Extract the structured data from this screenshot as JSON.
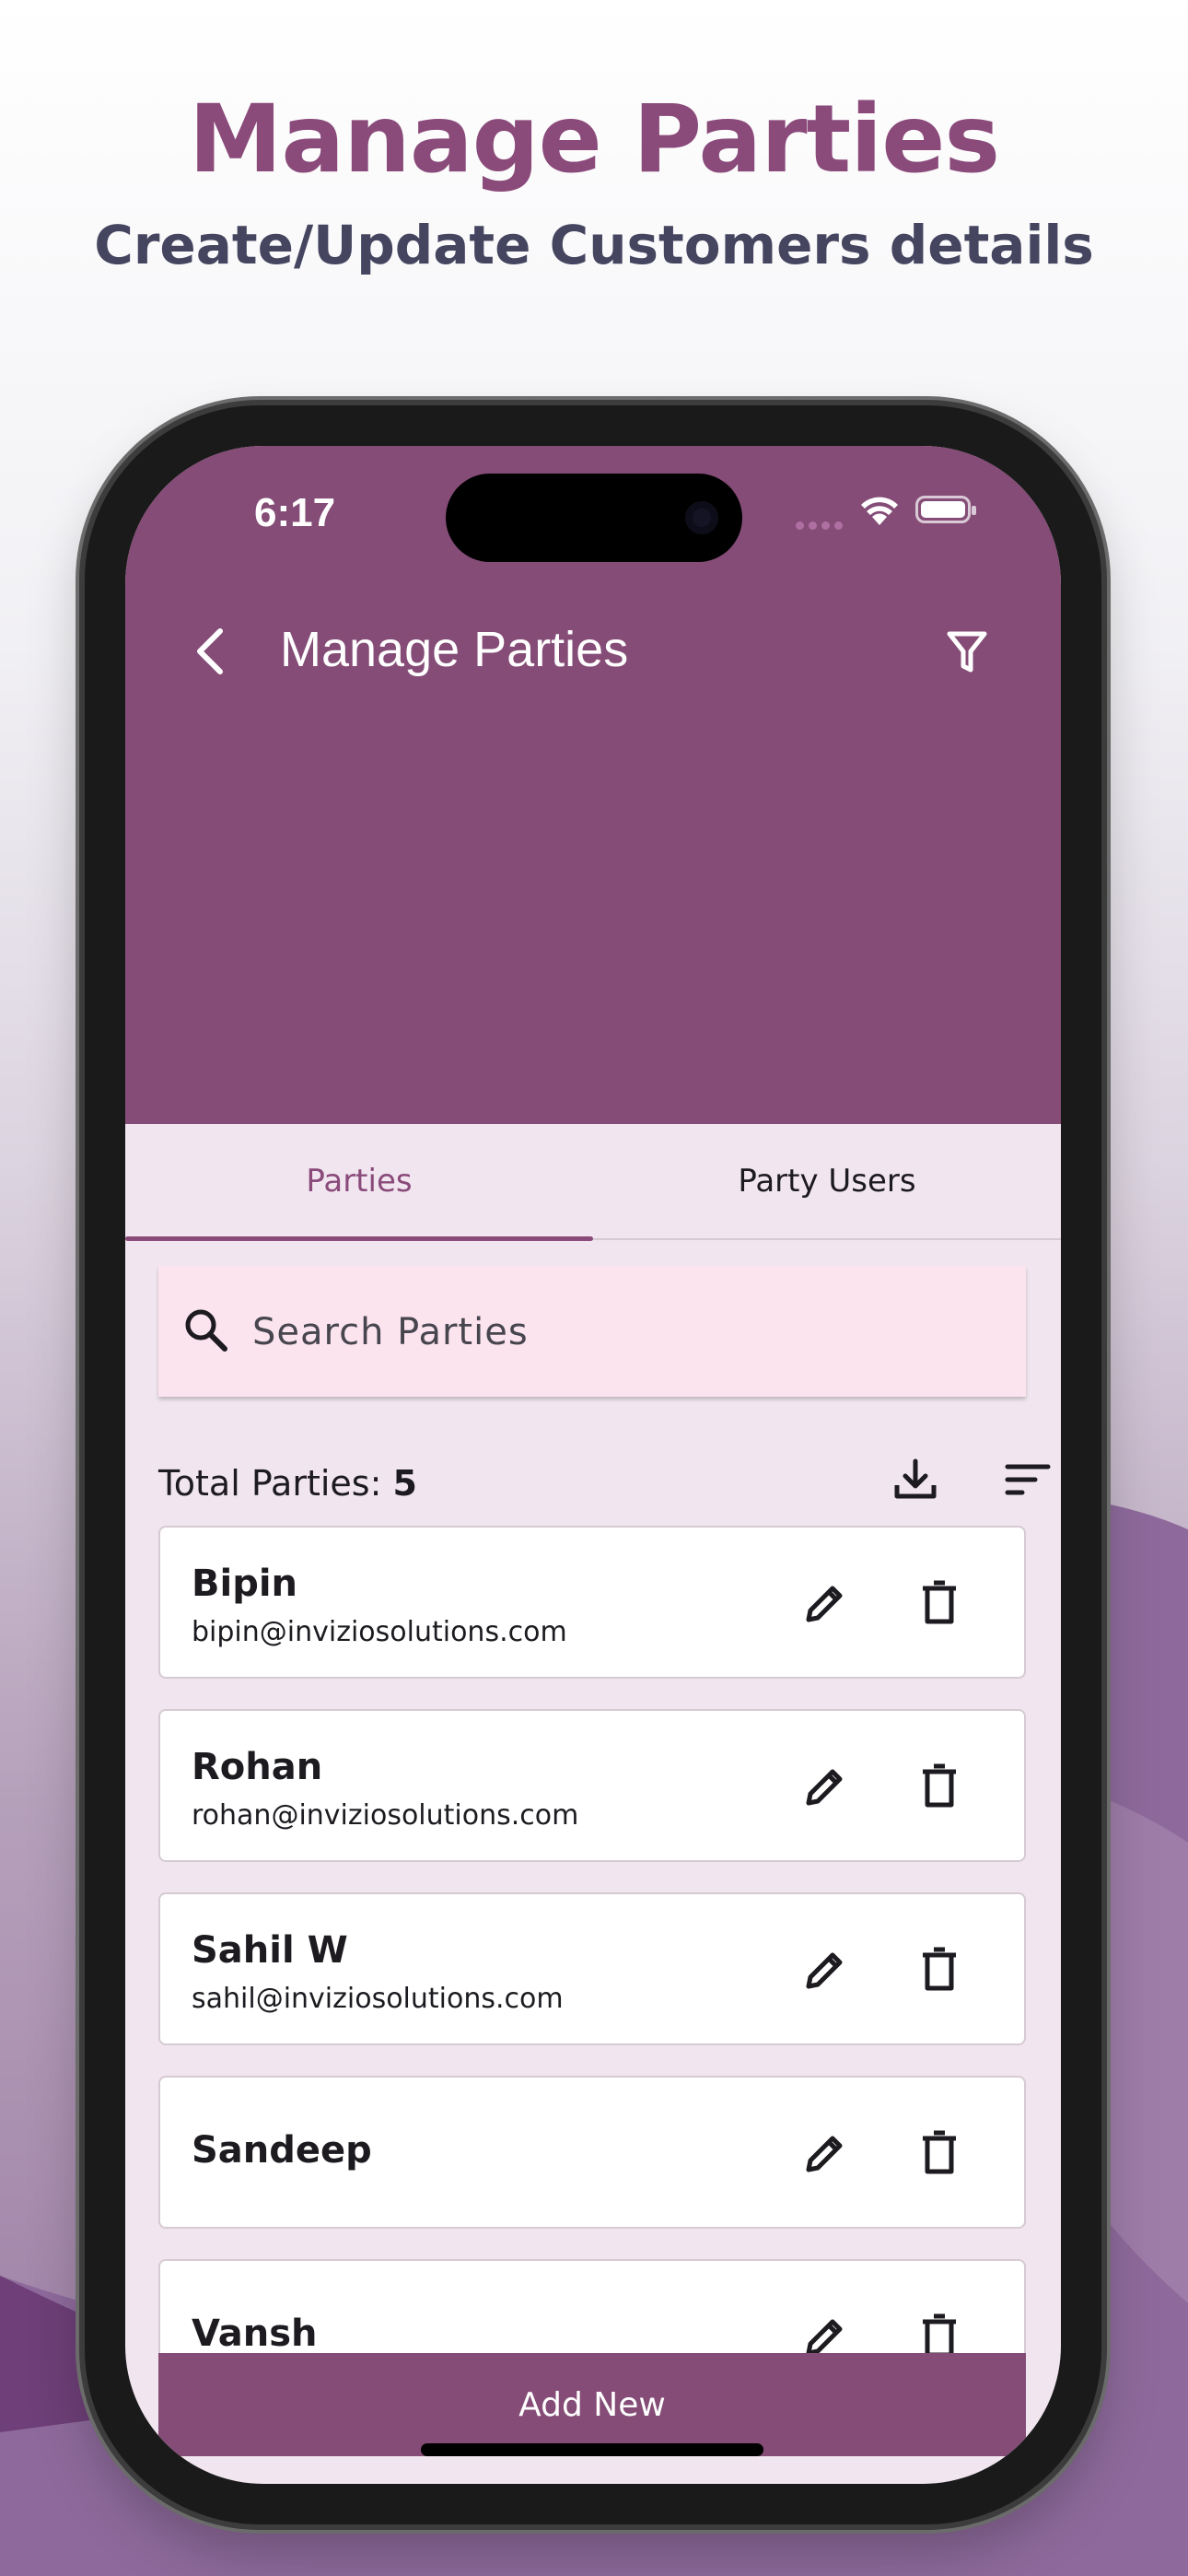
{
  "promo": {
    "title": "Manage Parties",
    "subtitle": "Create/Update Customers details"
  },
  "status_bar": {
    "time": "6:17"
  },
  "app_bar": {
    "title": "Manage Parties",
    "back_icon": "chevron-left-icon",
    "filter_icon": "filter-icon"
  },
  "tabs": [
    {
      "label": "Parties",
      "active": true
    },
    {
      "label": "Party Users",
      "active": false
    }
  ],
  "search": {
    "placeholder": "Search Parties",
    "value": ""
  },
  "totals": {
    "label": "Total Parties:",
    "count": "5"
  },
  "parties": [
    {
      "name": "Bipin",
      "email": "bipin@inviziosolutions.com"
    },
    {
      "name": "Rohan",
      "email": "rohan@inviziosolutions.com"
    },
    {
      "name": "Sahil W",
      "email": "sahil@inviziosolutions.com"
    },
    {
      "name": "Sandeep",
      "email": ""
    },
    {
      "name": "Vansh",
      "email": ""
    }
  ],
  "add_button": {
    "label": "Add New"
  },
  "colors": {
    "primary": "#844c76",
    "accent": "#8a4a7a",
    "surface": "#f1e6ef",
    "search_bg": "#fce4ef"
  }
}
